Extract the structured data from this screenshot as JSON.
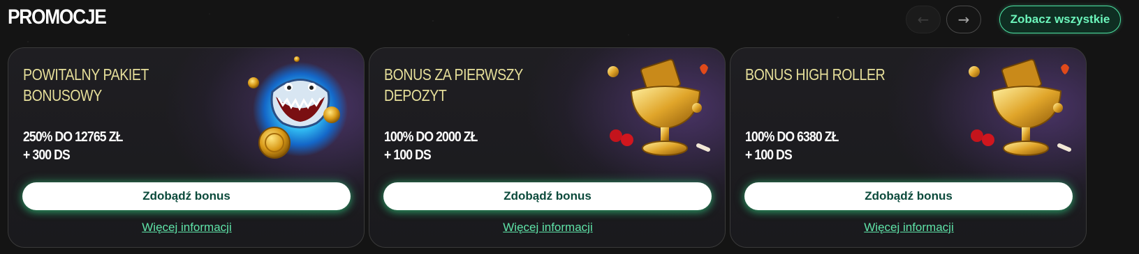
{
  "section": {
    "title": "PROMOCJE",
    "see_all_label": "Zobacz wszystkie",
    "prev_arrow": "←",
    "next_arrow": "→"
  },
  "cards": [
    {
      "title": "POWITALNY PAKIET BONUSOWY",
      "offer_line1": "250% DO 12765 ZŁ",
      "offer_line2": "+ 300 DS",
      "cta_label": "Zdobądź bonus",
      "more_label": "Więcej informacji",
      "art": "shark-coin-icon"
    },
    {
      "title": "BONUS ZA PIERWSZY DEPOZYT",
      "offer_line1": "100% DO 2000 ZŁ",
      "offer_line2": "+ 100 DS",
      "cta_label": "Zdobądź bonus",
      "more_label": "Więcej informacji",
      "art": "golden-trophy-icon"
    },
    {
      "title": "BONUS HIGH ROLLER",
      "offer_line1": "100% DO 6380 ZŁ",
      "offer_line2": "+ 100 DS",
      "cta_label": "Zdobądź bonus",
      "more_label": "Więcej informacji",
      "art": "golden-trophy-icon"
    }
  ],
  "colors": {
    "accent_green": "#4ce3a3",
    "title_yellow": "#e6df9a",
    "cta_text": "#0b4a3b"
  }
}
